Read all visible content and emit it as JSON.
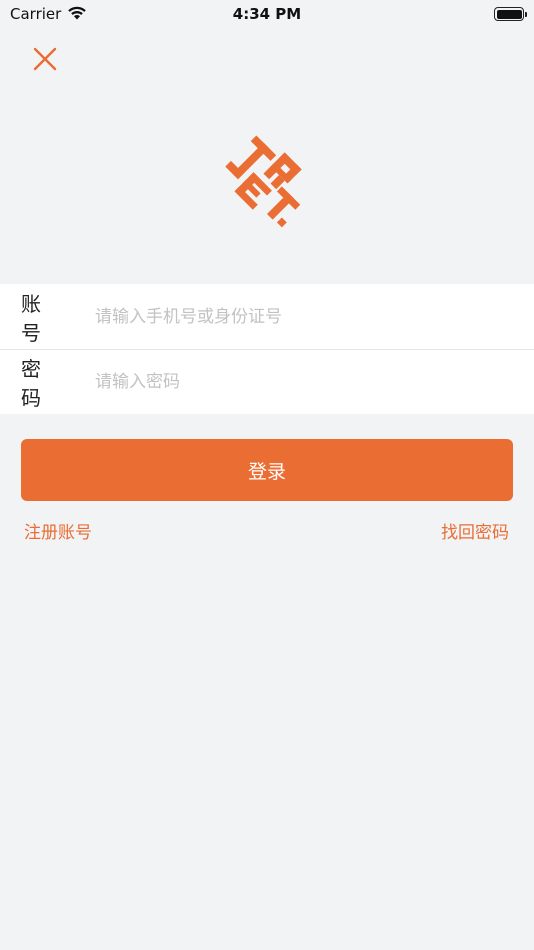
{
  "status_bar": {
    "carrier": "Carrier",
    "time": "4:34 PM",
    "wifi_icon": "wifi-icon",
    "battery_icon": "battery-icon"
  },
  "header": {
    "close_icon": "close-icon"
  },
  "logo": {
    "icon": "brand-logo",
    "color": "#ea6d33"
  },
  "form": {
    "account_label": "账 号",
    "account_placeholder": "请输入手机号或身份证号",
    "account_value": "",
    "password_label": "密 码",
    "password_placeholder": "请输入密码",
    "password_value": ""
  },
  "actions": {
    "login_label": "登录",
    "register_label": "注册账号",
    "forgot_label": "找回密码"
  },
  "colors": {
    "accent": "#ea6d33",
    "background": "#f2f3f5",
    "placeholder": "#c2c2c2"
  }
}
